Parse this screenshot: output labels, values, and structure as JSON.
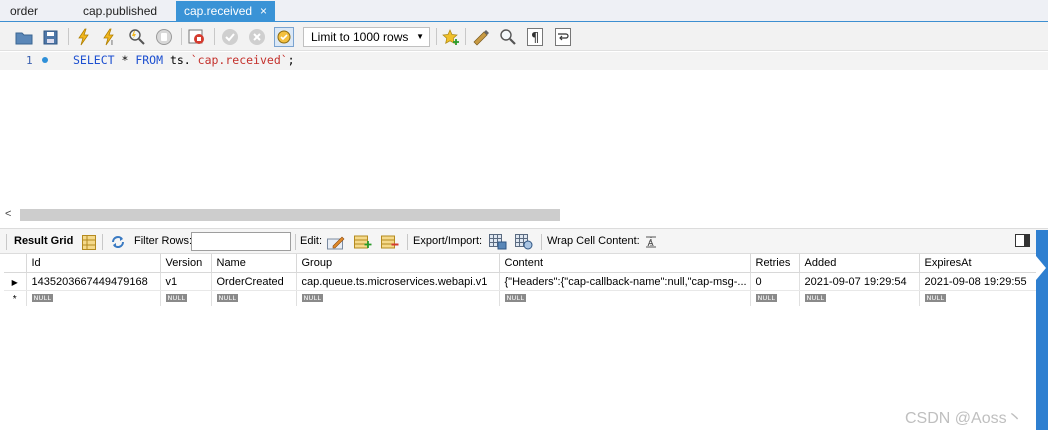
{
  "tabs": [
    {
      "label": "order"
    },
    {
      "label": "cap.published"
    },
    {
      "label": "cap.received",
      "active": true,
      "close": "×"
    }
  ],
  "query_toolbar": {
    "limit_label": "Limit to 1000 rows",
    "icons": [
      "open-folder",
      "save",
      "execute",
      "execute-selection",
      "explain",
      "stop",
      "toggle-autocommit-error",
      "commit",
      "rollback",
      "toggle-autocommit",
      "add-snippet",
      "beautify",
      "find",
      "invisible-chars",
      "wrap-lines"
    ]
  },
  "editor": {
    "line_number": "1",
    "code": {
      "select": "SELECT",
      "star": " * ",
      "from": "FROM",
      "schema": " ts.",
      "table": "`cap.received`",
      "end": ";"
    }
  },
  "results_toolbar": {
    "result_grid": "Result Grid",
    "filter_rows": "Filter Rows:",
    "filter_value": "",
    "edit": "Edit:",
    "export_import": "Export/Import:",
    "wrap_cell": "Wrap Cell Content:"
  },
  "grid": {
    "columns": [
      "Id",
      "Version",
      "Name",
      "Group",
      "Content",
      "Retries",
      "Added",
      "ExpiresAt"
    ],
    "rows": [
      [
        "1435203667449479168",
        "v1",
        "OrderCreated",
        "cap.queue.ts.microservices.webapi.v1",
        "{\"Headers\":{\"cap-callback-name\":null,\"cap-msg-...",
        "0",
        "2021-09-07 19:29:54",
        "2021-09-08 19:29:55"
      ]
    ],
    "null_label": "NULL",
    "new_row_marker": "*",
    "current_row_marker": "▶"
  },
  "watermark": "CSDN @Aoss丶",
  "colors": {
    "tab_active": "#3a93d6",
    "keyword": "#1c4fd0",
    "string": "#c4302b",
    "side_tab": "#2e7fd0"
  }
}
